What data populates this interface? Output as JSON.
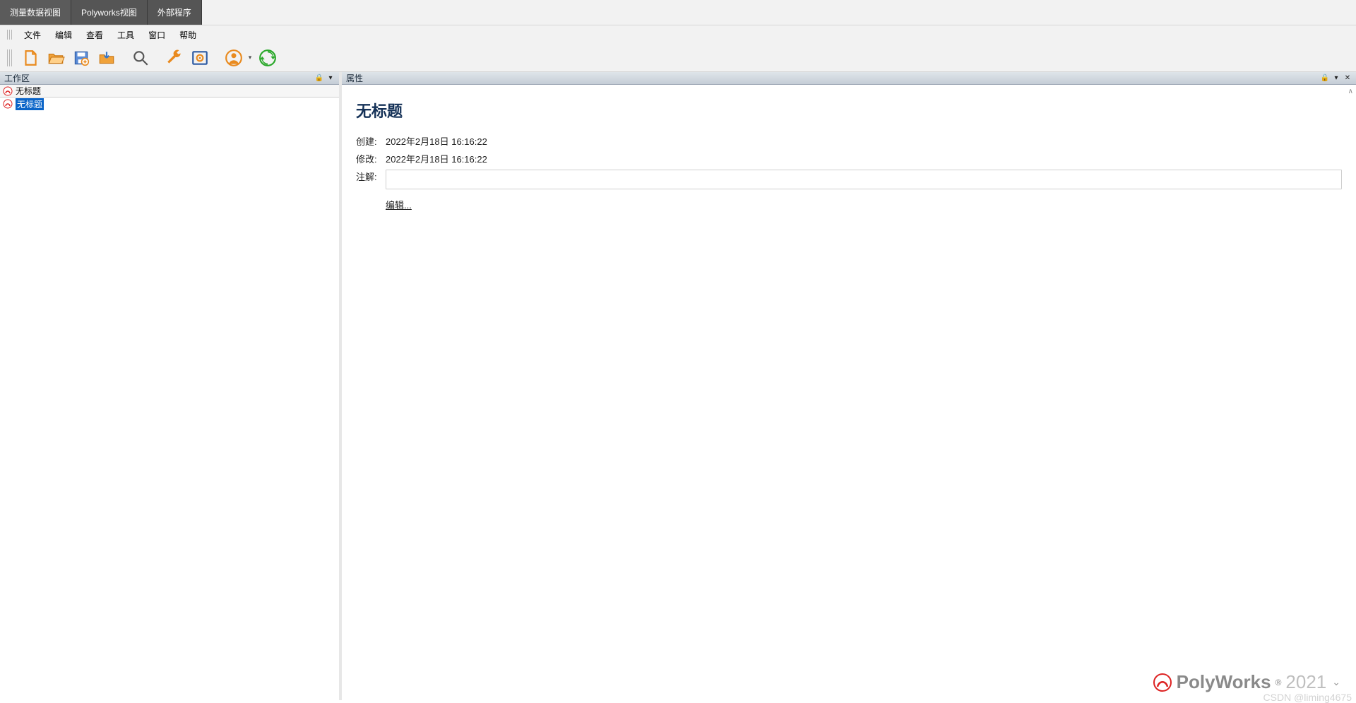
{
  "tabs": [
    "测量数据视图",
    "Polyworks视图",
    "外部程序"
  ],
  "menu": [
    "文件",
    "编辑",
    "查看",
    "工具",
    "窗口",
    "帮助"
  ],
  "toolbar_icons": [
    "new-file-icon",
    "open-folder-icon",
    "save-icon",
    "import-icon",
    "search-icon",
    "wrench-icon",
    "settings-icon",
    "user-icon",
    "reload-icon"
  ],
  "panels": {
    "workspace_title": "工作区",
    "properties_title": "属性"
  },
  "tree": {
    "root": "无标题",
    "child": "无标题"
  },
  "properties": {
    "heading": "无标题",
    "created_label": "创建:",
    "created_value": "2022年2月18日 16:16:22",
    "modified_label": "修改:",
    "modified_value": "2022年2月18日 16:16:22",
    "notes_label": "注解:",
    "edit_label": "编辑..."
  },
  "brand": {
    "name": "PolyWorks",
    "year": "2021",
    "reg": "®"
  },
  "watermark": "CSDN @liming4675"
}
